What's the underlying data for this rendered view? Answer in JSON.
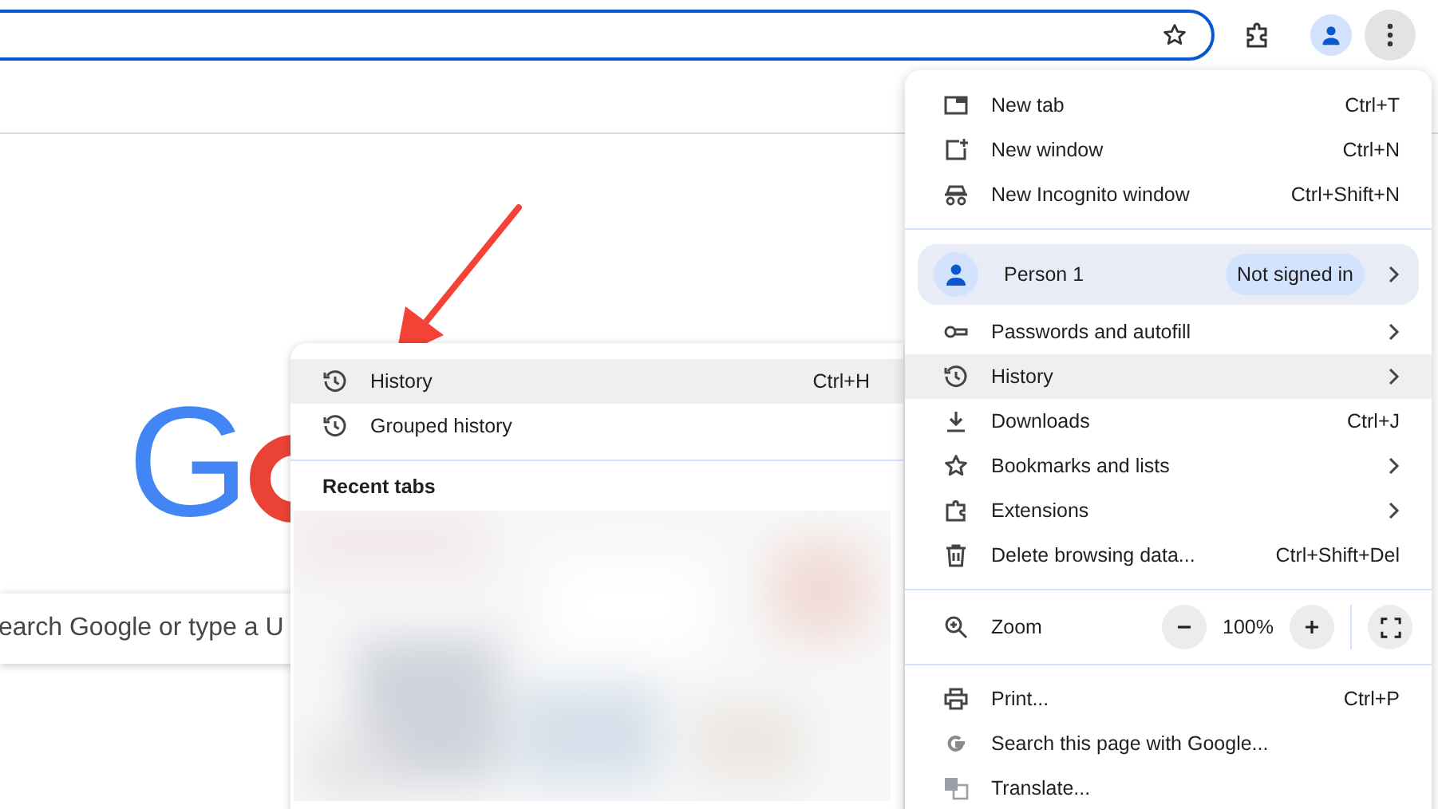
{
  "toolbar": {
    "menu_open": true
  },
  "page": {
    "logo": [
      {
        "text": "G",
        "color": "#4285f4"
      }
    ],
    "search_box": {
      "placeholder": "earch Google or type a U"
    }
  },
  "main_menu": {
    "sections": [
      {
        "items": [
          {
            "kind": "item",
            "label": "New tab",
            "shortcut": "Ctrl+T",
            "has_submenu": false,
            "highlighted": false
          },
          {
            "kind": "item",
            "label": "New window",
            "shortcut": "Ctrl+N",
            "has_submenu": false,
            "highlighted": false
          },
          {
            "kind": "item",
            "label": "New Incognito window",
            "shortcut": "Ctrl+Shift+N",
            "has_submenu": false,
            "highlighted": false
          }
        ]
      },
      {
        "items": [
          {
            "kind": "profile",
            "label": "Person 1",
            "badge": "Not signed in",
            "has_submenu": true,
            "highlighted": false
          },
          {
            "kind": "item",
            "label": "Passwords and autofill",
            "has_submenu": true,
            "highlighted": false
          },
          {
            "kind": "item",
            "label": "History",
            "has_submenu": true,
            "highlighted": true
          },
          {
            "kind": "item",
            "label": "Downloads",
            "shortcut": "Ctrl+J",
            "has_submenu": false,
            "highlighted": false
          },
          {
            "kind": "item",
            "label": "Bookmarks and lists",
            "has_submenu": true,
            "highlighted": false
          },
          {
            "kind": "item",
            "label": "Extensions",
            "has_submenu": true,
            "highlighted": false
          },
          {
            "kind": "item",
            "label": "Delete browsing data...",
            "shortcut": "Ctrl+Shift+Del",
            "has_submenu": false,
            "highlighted": false
          }
        ]
      },
      {
        "items": [
          {
            "kind": "zoom",
            "label": "Zoom",
            "value": "100%",
            "highlighted": false
          }
        ]
      },
      {
        "items": [
          {
            "kind": "item",
            "label": "Print...",
            "shortcut": "Ctrl+P",
            "has_submenu": false,
            "highlighted": false
          },
          {
            "kind": "item",
            "label": "Search this page with Google...",
            "has_submenu": false,
            "highlighted": false
          },
          {
            "kind": "item",
            "label": "Translate...",
            "has_submenu": false,
            "highlighted": false
          }
        ]
      }
    ]
  },
  "history_submenu": {
    "items": [
      {
        "label": "History",
        "shortcut": "Ctrl+H",
        "highlighted": true
      },
      {
        "label": "Grouped history",
        "highlighted": false
      }
    ],
    "section_title": "Recent tabs"
  }
}
